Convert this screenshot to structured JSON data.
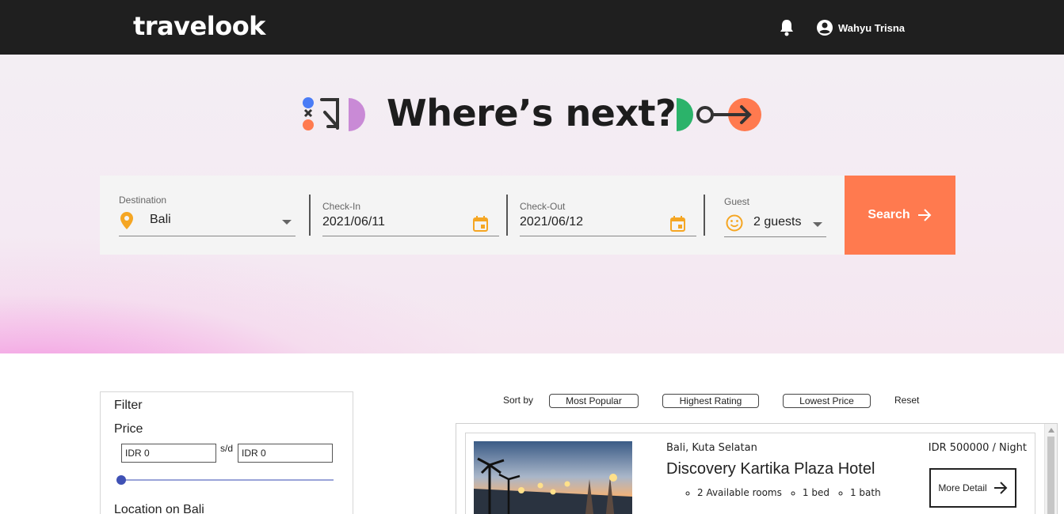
{
  "header": {
    "logo": "travelook",
    "user_name": "Wahyu Trisna",
    "colors": {
      "bar": "#1f1f1f"
    }
  },
  "hero": {
    "headline": "Where’s next?"
  },
  "search": {
    "destination": {
      "label": "Destination",
      "value": "Bali"
    },
    "checkin": {
      "label": "Check-In",
      "value": "2021/06/11"
    },
    "checkout": {
      "label": "Check-Out",
      "value": "2021/06/12"
    },
    "guest": {
      "label": "Guest",
      "value": "2 guests"
    },
    "button": "Search",
    "colors": {
      "button": "#ff7a4f",
      "icon": "#f5a623"
    }
  },
  "filter": {
    "title": "Filter",
    "price_title": "Price",
    "min_value": "IDR 0",
    "max_value": "IDR 0",
    "separator": "s/d",
    "slider_fraction": 0,
    "location_title": "Location on Bali"
  },
  "sort": {
    "label": "Sort by",
    "options": [
      "Most Popular",
      "Highest Rating",
      "Lowest Price"
    ],
    "reset": "Reset"
  },
  "results": [
    {
      "location": "Bali, Kuta Selatan",
      "name": "Discovery Kartika Plaza Hotel",
      "amenities": [
        "2 Available rooms",
        "1 bed",
        "1 bath"
      ],
      "price": "IDR 500000 / Night",
      "button": "More Detail"
    }
  ]
}
